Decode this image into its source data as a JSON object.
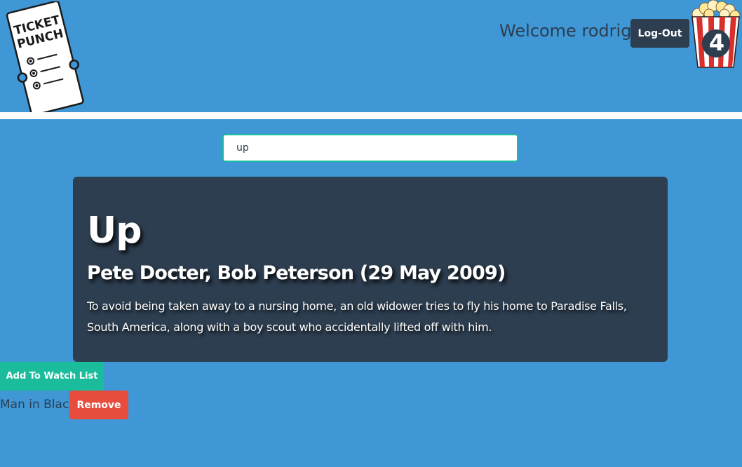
{
  "header": {
    "logo_text_line1": "TICKET",
    "logo_text_line2": "PUNCH",
    "welcome_text": "Welcome rodrigo",
    "logout_label": "Log-Out",
    "watchlist_count": "4"
  },
  "search": {
    "value": "up"
  },
  "movie": {
    "title": "Up",
    "director_and_date": "Pete Docter, Bob Peterson (29 May 2009)",
    "plot": "To avoid being taken away to a nursing home, an old widower tries to fly his home to Paradise Falls, South America, along with a boy scout who accidentally lifted off with him.",
    "add_label": "Add To Watch List"
  },
  "watch_list": {
    "items": [
      {
        "title": "Man in Black",
        "remove_label": "Remove"
      }
    ]
  },
  "colors": {
    "background": "#3f97d6",
    "card": "#2d3e50",
    "accent_green": "#1abc9c",
    "danger_red": "#e74c3c",
    "dark_text": "#2c3e50"
  }
}
